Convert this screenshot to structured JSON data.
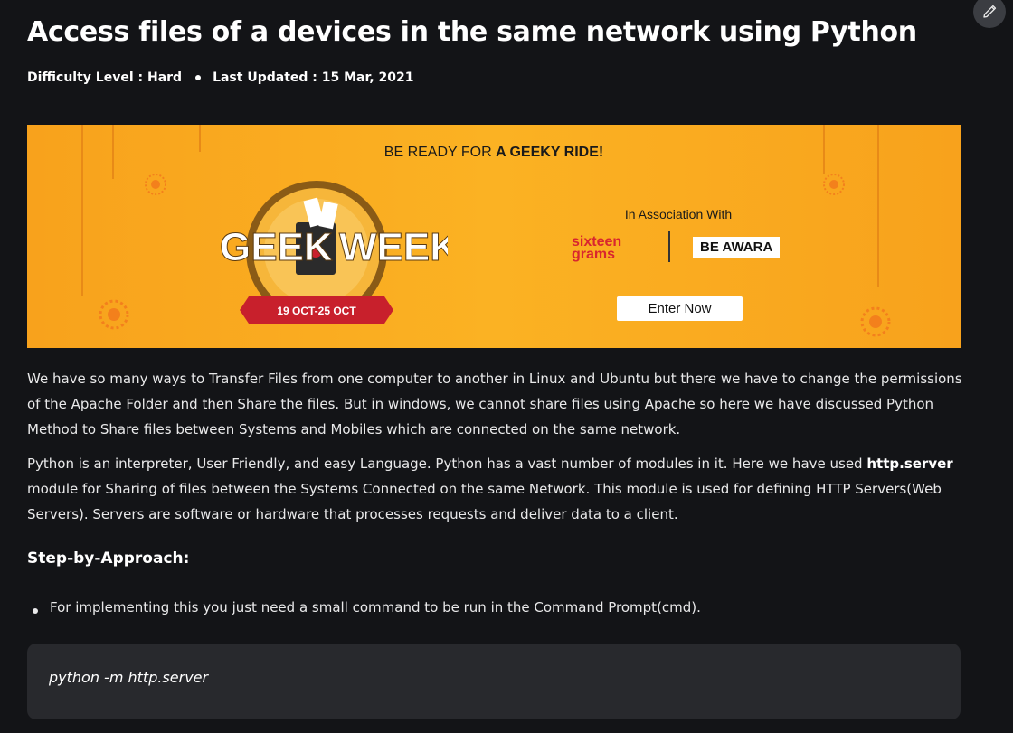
{
  "article": {
    "title": "Access files of a devices in the same network using Python",
    "difficulty": "Difficulty Level : Hard",
    "last_updated": "Last Updated : 15 Mar, 2021"
  },
  "banner": {
    "headline_prefix": "BE READY FOR ",
    "headline_bold": "A GEEKY RIDE!",
    "logo_text_left": "GEEK",
    "logo_text_right": "WEEK",
    "logo_dates": "19 OCT-25 OCT",
    "association": "In Association With",
    "sponsor1": "sixteen grams",
    "sponsor2": "BE AWARA",
    "cta": "Enter Now",
    "colors": {
      "background": "#fbb223",
      "ribbon": "#c8202c",
      "badge": "#2b2b2b"
    }
  },
  "body": {
    "para1": "We have so many ways to Transfer Files from one computer to another in Linux and Ubuntu but there we have to change the permissions of the Apache Folder and then Share the files. But in windows, we cannot share files using Apache so here we have discussed Python Method to Share files between Systems and Mobiles which are connected on the same network.",
    "para2_before": "Python is an interpreter, User Friendly, and easy Language. Python has a vast number of modules in it. Here we have used ",
    "para2_bold": "http.server",
    "para2_after": " module for Sharing of files between the Systems Connected on the same Network. This module is used for defining HTTP Servers(Web Servers). Servers are software or hardware that processes requests and deliver data to a client.",
    "heading": "Step-by-Approach:",
    "bullet1": "For implementing this you just need a small command to be run in the Command Prompt(cmd).",
    "code": "python -m http.server"
  },
  "icons": {
    "edit": "pencil-icon"
  }
}
